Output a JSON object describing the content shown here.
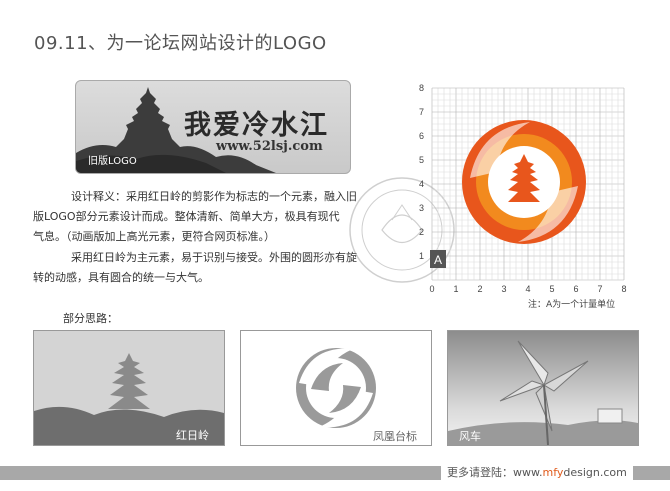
{
  "title": "09.11、为一论坛网站设计的LOGO",
  "old_logo": {
    "cn_text": "我爱冷水江",
    "url_text": "www.52lsj.com",
    "tag": "旧版LOGO"
  },
  "description": {
    "p1_lines": [
      "设计释义：采用红日岭的剪影作为标志的一个元素，融入旧",
      "版LOGO部分元素设计而成。整体清新、简单大方，极具有现代",
      "气息。（动画版加上高光元素，更符合网页标准。）"
    ],
    "p2_lines": [
      "采用红日岭为主元素，易于识别与接受。外围的圆形亦有旋",
      "转的动感，具有圆合的统一与大气。"
    ]
  },
  "grid": {
    "y_ticks": [
      "8",
      "7",
      "6",
      "5",
      "4",
      "3",
      "2",
      "1"
    ],
    "x_ticks": [
      "0",
      "1",
      "2",
      "3",
      "4",
      "5",
      "6",
      "7",
      "8"
    ],
    "unit_label": "A",
    "note": "注：A为一个计量单位",
    "logo_colors": {
      "outer": "#e8561c",
      "inner": "#f28a1e",
      "center": "#ffffff"
    }
  },
  "section_label": "部分思路：",
  "photos": [
    {
      "caption": "红日岭"
    },
    {
      "caption": "凤凰台标"
    },
    {
      "caption": "风车"
    }
  ],
  "footer": {
    "prefix": "更多请登陆：www.",
    "accent": "mfy",
    "suffix": "design.com",
    "accent_color": "#e05a1a"
  }
}
